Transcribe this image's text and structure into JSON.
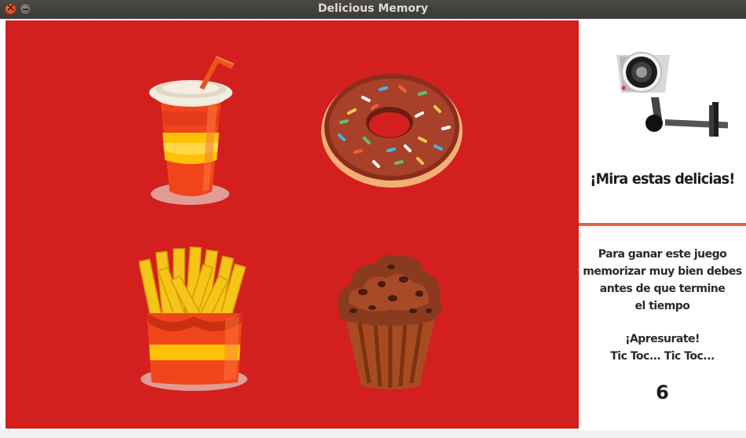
{
  "window": {
    "title": "Delicious Memory"
  },
  "board": {
    "background_color": "#d41f1f",
    "cards": [
      {
        "name": "soda-cup",
        "face_up": true
      },
      {
        "name": "donut",
        "face_up": true
      },
      {
        "name": "french-fries",
        "face_up": true
      },
      {
        "name": "muffin",
        "face_up": true
      }
    ]
  },
  "side": {
    "camera_icon": "security-camera-icon",
    "tagline": "¡Mira estas delicias!",
    "instructions": [
      "Para ganar este juego",
      "memorizar muy bien debes",
      "antes de que termine",
      "el tiempo",
      "¡Apresurate!",
      "Tic Toc... Tic Toc..."
    ],
    "timer": "6"
  }
}
